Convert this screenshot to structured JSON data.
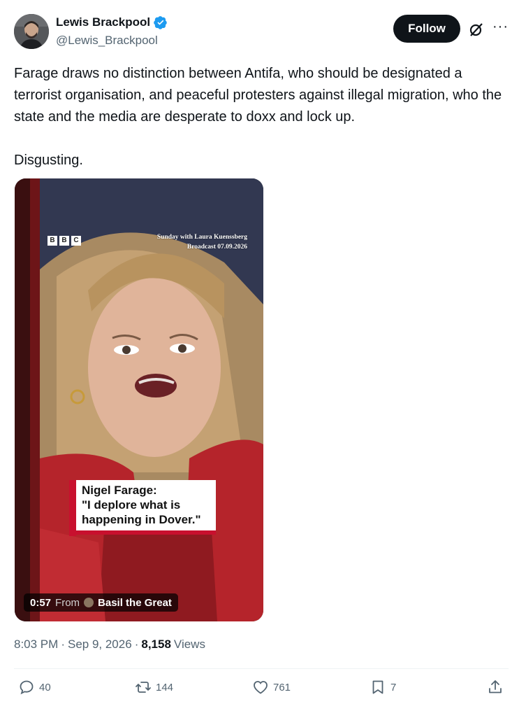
{
  "author": {
    "name": "Lewis Brackpool",
    "handle": "@Lewis_Brackpool",
    "follow_label": "Follow"
  },
  "tweet": {
    "text": "Farage draws no distinction between Antifa, who should be designated a terrorist organisation, and peaceful protesters against illegal migration, who the state and the media are desperate to doxx and lock up.\n\nDisgusting."
  },
  "video": {
    "bbc_letters": [
      "B",
      "B",
      "C"
    ],
    "show_title": "Sunday with Laura Kuenssberg",
    "broadcast": "Broadcast 07.09.2026",
    "caption_line1": "Nigel Farage:",
    "caption_line2": "\"I deplore what is",
    "caption_line3": "happening in Dover.\"",
    "duration": "0:57",
    "from_label": "From",
    "source_name": "Basil the Great"
  },
  "meta": {
    "time": "8:03 PM",
    "sep1": "·",
    "date": "Sep 9, 2026",
    "sep2": "·",
    "views_count": "8,158",
    "views_label": "Views"
  },
  "actions": {
    "replies": "40",
    "reposts": "144",
    "likes": "761",
    "bookmarks": "7"
  },
  "colors": {
    "follow_bg": "#0f1419",
    "secondary_text": "#536471",
    "verified_blue": "#1d9bf0",
    "bbc_red": "#c8102e"
  },
  "icons": [
    "verified-icon",
    "grok-icon",
    "more-icon",
    "reply-icon",
    "repost-icon",
    "like-icon",
    "bookmark-icon",
    "share-icon"
  ]
}
